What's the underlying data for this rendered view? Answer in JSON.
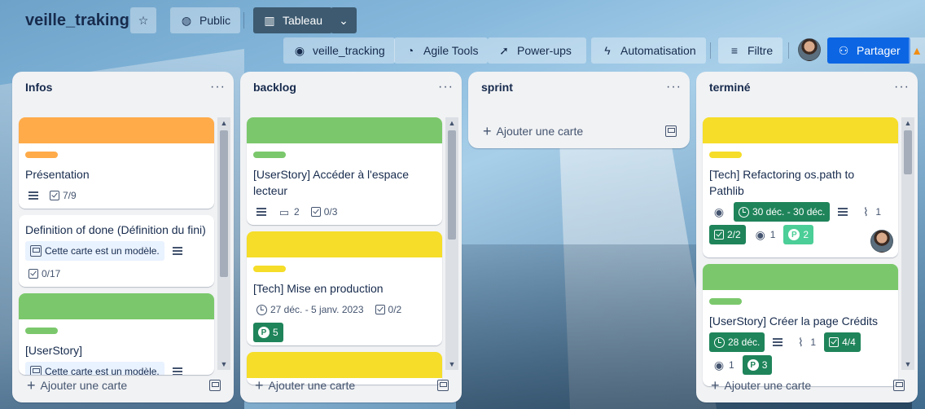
{
  "board": {
    "title": "veille_traking",
    "visibility_label": "Public",
    "view_label": "Tableau"
  },
  "toolbar": {
    "github_label": "veille_tracking",
    "agile_label": "Agile Tools",
    "powerups_label": "Power-ups",
    "automation_label": "Automatisation",
    "filter_label": "Filtre",
    "share_label": "Partager"
  },
  "add_card_label": "Ajouter une carte",
  "lists": [
    {
      "title": "Infos",
      "cards": [
        {
          "cover": "#ffab4a",
          "label": "#ffab4a",
          "title": "Présentation",
          "checklist": "7/9"
        },
        {
          "title": "Definition of done (Définition du fini)",
          "template": "Cette carte est un modèle.",
          "checklist": "0/17"
        },
        {
          "cover": "#7bc86c",
          "label": "#7bc86c",
          "title": "[UserStory]",
          "template": "Cette carte est un modèle."
        }
      ]
    },
    {
      "title": "backlog",
      "cards": [
        {
          "cover": "#7bc86c",
          "label": "#7bc86c",
          "title": "[UserStory] Accéder à l'espace lecteur",
          "comments": "2",
          "checklist": "0/3"
        },
        {
          "cover": "#f5dd29",
          "label": "#f5dd29",
          "title": "[Tech] Mise en production",
          "dates": "27 déc. - 5 janv. 2023",
          "checklist": "0/2",
          "points": "5"
        },
        {
          "cover": "#f5dd29"
        }
      ]
    },
    {
      "title": "sprint",
      "cards": []
    },
    {
      "title": "terminé",
      "cards": [
        {
          "cover": "#f5dd29",
          "label": "#f5dd29",
          "title": "[Tech] Refactoring os.path to Pathlib",
          "dates": "30 déc. - 30 déc.",
          "attachments": "1",
          "checklist": "2/2",
          "github": "1",
          "points": "2"
        },
        {
          "cover": "#7bc86c",
          "label": "#7bc86c",
          "title": "[UserStory] Créer la page Crédits",
          "dates": "28 déc.",
          "attachments": "1",
          "checklist": "4/4",
          "github": "1",
          "points": "3"
        }
      ]
    }
  ],
  "colors": {
    "list_bg": "#f1f2f4",
    "share_button": "#0c66e4",
    "complete_green": "#1f845a"
  }
}
